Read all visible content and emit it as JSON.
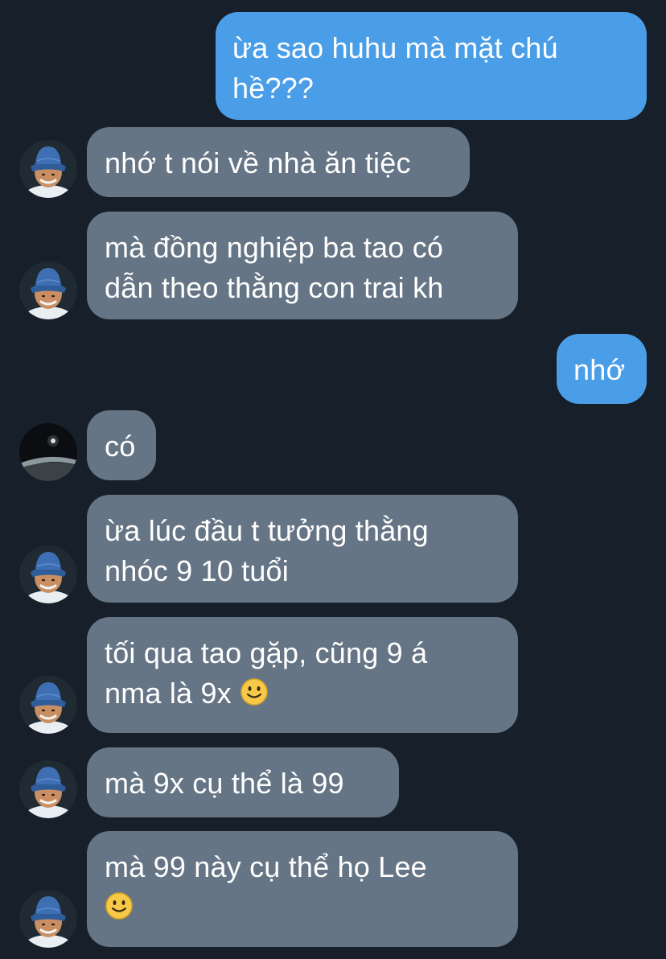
{
  "messages": [
    {
      "direction": "outgoing",
      "lines": [
        "ừa sao huhu mà mặt chú",
        "hề???"
      ]
    },
    {
      "direction": "incoming",
      "avatar": "profile-photo-bucket-hat",
      "lines": [
        "nhớ t nói về nhà ăn tiệc"
      ]
    },
    {
      "direction": "incoming",
      "avatar": "profile-photo-bucket-hat",
      "lines": [
        "mà đồng nghiệp ba tao có",
        "dẫn theo thằng con trai kh"
      ]
    },
    {
      "direction": "outgoing",
      "lines": [
        "nhớ"
      ]
    },
    {
      "direction": "incoming",
      "avatar": "profile-photo-dark-eclipse",
      "lines": [
        "có"
      ]
    },
    {
      "direction": "incoming",
      "avatar": "profile-photo-bucket-hat",
      "lines": [
        "ừa lúc đầu t tưởng thằng",
        "nhóc 9 10 tuổi"
      ]
    },
    {
      "direction": "incoming",
      "avatar": "profile-photo-bucket-hat",
      "lines": [
        "tối qua tao gặp, cũng 9 á",
        "nma là 9x"
      ],
      "emoji": "slightly-smiling-face-emoji"
    },
    {
      "direction": "incoming",
      "avatar": "profile-photo-bucket-hat",
      "lines": [
        "mà 9x cụ thể là 99"
      ]
    },
    {
      "direction": "incoming",
      "avatar": "profile-photo-bucket-hat",
      "lines": [
        "mà 99 này cụ thể họ Lee",
        ""
      ],
      "emoji": "slightly-smiling-face-emoji"
    }
  ],
  "colors": {
    "background": "#17202a",
    "outgoing_bubble": "#4a9ee8",
    "incoming_bubble": "#667585",
    "text": "#ffffff"
  }
}
